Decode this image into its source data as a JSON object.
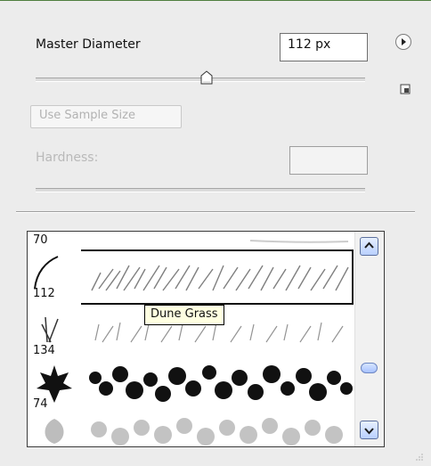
{
  "master_diameter": {
    "label": "Master Diameter",
    "value": "112 px",
    "slider_fraction": 0.52
  },
  "buttons": {
    "use_sample_size": "Use Sample Size"
  },
  "hardness": {
    "label": "Hardness:",
    "value": ""
  },
  "icons": {
    "menu": "menu-arrow-icon",
    "new_preset": "new-preset-icon",
    "resize_grip": "resize-grip-icon"
  },
  "brushes": {
    "items": [
      {
        "size": "70",
        "name": "",
        "selected": false
      },
      {
        "size": "112",
        "name": "Dune Grass",
        "selected": true
      },
      {
        "size": "134",
        "name": "",
        "selected": false
      },
      {
        "size": "74",
        "name": "",
        "selected": false
      },
      {
        "size": "",
        "name": "",
        "selected": false
      }
    ],
    "tooltip": "Dune Grass"
  },
  "colors": {
    "selection_border": "#111111",
    "tooltip_bg": "#ffffe1",
    "scroll_accent": "#b9d0ff"
  }
}
